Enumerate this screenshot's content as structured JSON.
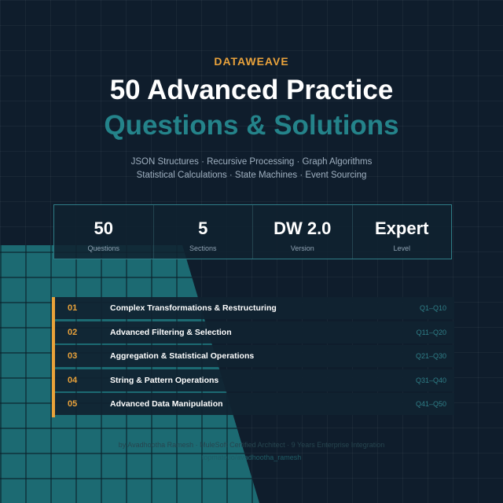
{
  "header": {
    "eyebrow": "DATAWEAVE",
    "title_line1": "50 Advanced Practice",
    "title_line2": "Questions & Solutions",
    "tagline_line1": "JSON Structures · Recursive Processing · Graph Algorithms",
    "tagline_line2": "Statistical Calculations · State Machines · Event Sourcing"
  },
  "stats": [
    {
      "value": "50",
      "label": "Questions"
    },
    {
      "value": "5",
      "label": "Sections"
    },
    {
      "value": "DW 2.0",
      "label": "Version"
    },
    {
      "value": "Expert",
      "label": "Level"
    }
  ],
  "sections": [
    {
      "number": "01",
      "title": "Complex Transformations & Restructuring",
      "range": "Q1–Q10"
    },
    {
      "number": "02",
      "title": "Advanced Filtering & Selection",
      "range": "Q11–Q20"
    },
    {
      "number": "03",
      "title": "Aggregation & Statistical Operations",
      "range": "Q21–Q30"
    },
    {
      "number": "04",
      "title": "String & Pattern Operations",
      "range": "Q31–Q40"
    },
    {
      "number": "05",
      "title": "Advanced Data Manipulation",
      "range": "Q41–Q50"
    }
  ],
  "footer": {
    "credit": "by Avadhootha Ramesh · MuleSoft Certified Architect · 9 Years Enterprise Integration",
    "link": "topmate.io/avadhootha_ramesh"
  },
  "colors": {
    "background": "#0f1d2c",
    "accent_orange": "#e9a23b",
    "accent_teal": "#24838a"
  }
}
